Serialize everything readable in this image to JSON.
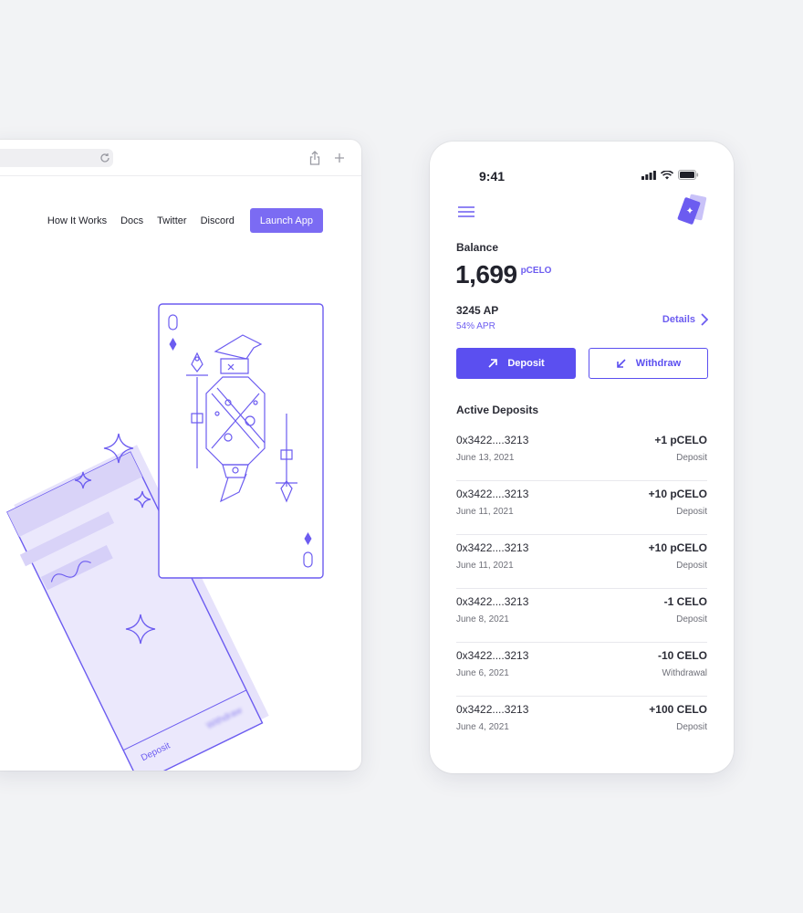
{
  "browser": {
    "nav": {
      "links": [
        "How It Works",
        "Docs",
        "Twitter",
        "Discord"
      ],
      "launch_label": "Launch App"
    },
    "hero": {
      "card_button_label": "Deposit",
      "card_button_blurred": "Withdraw"
    }
  },
  "phone": {
    "status": {
      "time": "9:41"
    },
    "balance": {
      "label": "Balance",
      "value": "1,699",
      "unit": "pCELO"
    },
    "ap": {
      "value": "3245 AP",
      "apr": "54% APR"
    },
    "details_label": "Details",
    "actions": {
      "deposit_label": "Deposit",
      "withdraw_label": "Withdraw"
    },
    "active_deposits": {
      "title": "Active Deposits",
      "items": [
        {
          "address": "0x3422....3213",
          "date": "June 13, 2021",
          "amount": "+1 pCELO",
          "type": "Deposit"
        },
        {
          "address": "0x3422....3213",
          "date": "June 11, 2021",
          "amount": "+10 pCELO",
          "type": "Deposit"
        },
        {
          "address": "0x3422....3213",
          "date": "June 11, 2021",
          "amount": "+10 pCELO",
          "type": "Deposit"
        },
        {
          "address": "0x3422....3213",
          "date": "June 8, 2021",
          "amount": "-1 CELO",
          "type": "Deposit"
        },
        {
          "address": "0x3422....3213",
          "date": "June 6, 2021",
          "amount": "-10 CELO",
          "type": "Withdrawal"
        },
        {
          "address": "0x3422....3213",
          "date": "June 4, 2021",
          "amount": "+100 CELO",
          "type": "Deposit"
        }
      ]
    }
  },
  "colors": {
    "accent": "#5b4ff0",
    "accent_light": "#7b6bf3",
    "illustration_fill": "#e6e2fb",
    "illustration_stroke": "#6c5cf0"
  },
  "icons": {
    "browser": [
      "reload-icon",
      "share-icon",
      "plus-icon"
    ],
    "phone": [
      "hamburger-menu-icon",
      "cards-logo-icon",
      "signal-icon",
      "wifi-icon",
      "battery-icon",
      "chevron-right-icon",
      "arrow-up-right-icon",
      "arrow-down-left-icon"
    ]
  }
}
